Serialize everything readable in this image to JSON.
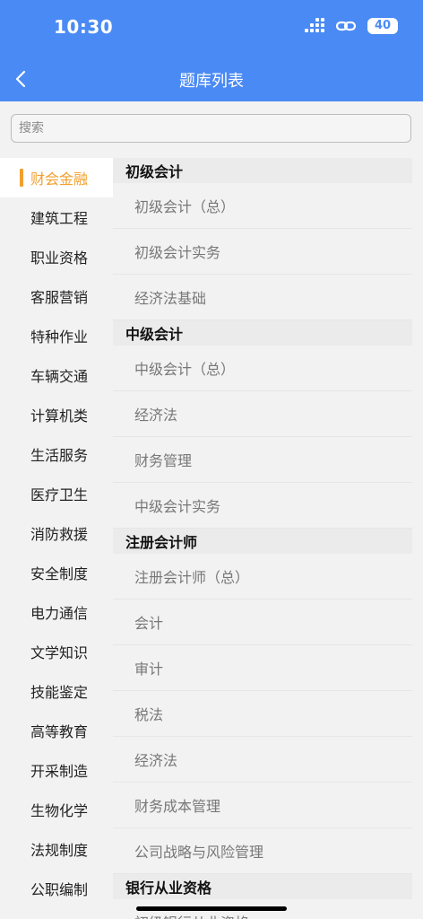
{
  "status_bar": {
    "time": "10:30",
    "battery": "40"
  },
  "header": {
    "title": "题库列表"
  },
  "search": {
    "placeholder": "搜索"
  },
  "sidebar": {
    "active_index": 0,
    "items": [
      "财会金融",
      "建筑工程",
      "职业资格",
      "客服营销",
      "特种作业",
      "车辆交通",
      "计算机类",
      "生活服务",
      "医疗卫生",
      "消防救援",
      "安全制度",
      "电力通信",
      "文学知识",
      "技能鉴定",
      "高等教育",
      "开采制造",
      "生物化学",
      "法规制度",
      "公职编制"
    ]
  },
  "sections": [
    {
      "title": "初级会计",
      "items": [
        "初级会计（总）",
        "初级会计实务",
        "经济法基础"
      ]
    },
    {
      "title": "中级会计",
      "items": [
        "中级会计（总）",
        "经济法",
        "财务管理",
        "中级会计实务"
      ]
    },
    {
      "title": "注册会计师",
      "items": [
        "注册会计师（总）",
        "会计",
        "审计",
        "税法",
        "经济法",
        "财务成本管理",
        "公司战略与风险管理"
      ]
    },
    {
      "title": "银行从业资格",
      "items": [
        "初级银行从业资格"
      ]
    }
  ],
  "colors": {
    "header": "#4a8af4",
    "active": "#f0a030"
  }
}
